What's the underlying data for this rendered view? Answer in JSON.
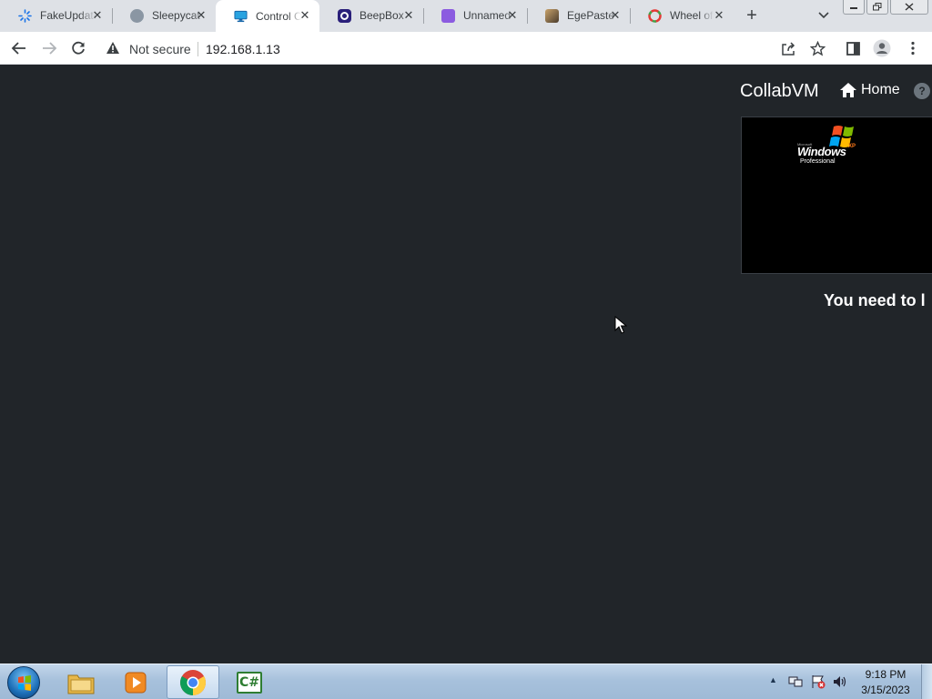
{
  "browser": {
    "tabs": [
      {
        "title": "FakeUpdates",
        "icon": "spinner-icon",
        "icon_color": "#1a73e8",
        "active": false
      },
      {
        "title": "Sleepycat",
        "icon": "cat-icon",
        "icon_color": "#6b7a88",
        "active": false
      },
      {
        "title": "Control Center",
        "icon": "monitor-icon",
        "icon_color": "#1e88c8",
        "active": true
      },
      {
        "title": "BeepBox",
        "icon": "beepbox-icon",
        "icon_color": "#3b2a9a",
        "active": false
      },
      {
        "title": "Unnamed",
        "icon": "cube-icon",
        "icon_color": "#7b4fd6",
        "active": false
      },
      {
        "title": "EgePaste",
        "icon": "painting-icon",
        "icon_color": "#5a4a3a",
        "active": false
      },
      {
        "title": "Wheel of Names",
        "icon": "wheel-icon",
        "icon_color": "#e53935",
        "active": false
      }
    ],
    "new_tab_label": "+",
    "address_bar": {
      "security_label": "Not secure",
      "url": "192.168.1.13"
    }
  },
  "page": {
    "brand": "CollabVM",
    "nav_home": "Home",
    "help_symbol": "?",
    "vm_screen": {
      "logo_word": "Windows",
      "logo_sup": "XP",
      "logo_edition": "Professional",
      "logo_small": "Microsoft"
    },
    "login_message": "You need to l"
  },
  "taskbar": {
    "apps": [
      {
        "name": "explorer-icon"
      },
      {
        "name": "media-player-icon"
      },
      {
        "name": "chrome-icon",
        "active": true
      },
      {
        "name": "csharp-icon",
        "label": "C#"
      }
    ],
    "clock_time": "9:18 PM",
    "clock_date": "3/15/2023"
  },
  "colors": {
    "page_bg": "#212529",
    "tabstrip_bg": "#dee1e6",
    "taskbar_bg": "#a7c1dc"
  }
}
